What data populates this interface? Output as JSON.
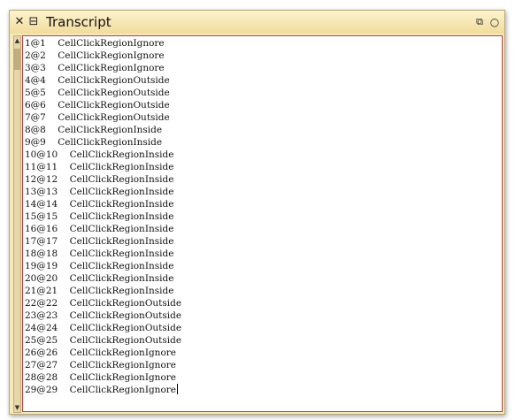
{
  "window": {
    "title": "Transcript",
    "icons": {
      "close": "close-icon",
      "menu": "window-menu-icon",
      "collapse": "collapse-icon",
      "expand": "expand-icon"
    }
  },
  "transcript": {
    "lines": [
      "1@1    CellClickRegionIgnore",
      "2@2    CellClickRegionIgnore",
      "3@3    CellClickRegionIgnore",
      "4@4    CellClickRegionOutside",
      "5@5    CellClickRegionOutside",
      "6@6    CellClickRegionOutside",
      "7@7    CellClickRegionOutside",
      "8@8    CellClickRegionInside",
      "9@9    CellClickRegionInside",
      "10@10    CellClickRegionInside",
      "11@11    CellClickRegionInside",
      "12@12    CellClickRegionInside",
      "13@13    CellClickRegionInside",
      "14@14    CellClickRegionInside",
      "15@15    CellClickRegionInside",
      "16@16    CellClickRegionInside",
      "17@17    CellClickRegionInside",
      "18@18    CellClickRegionInside",
      "19@19    CellClickRegionInside",
      "20@20    CellClickRegionInside",
      "21@21    CellClickRegionInside",
      "22@22    CellClickRegionOutside",
      "23@23    CellClickRegionOutside",
      "24@24    CellClickRegionOutside",
      "25@25    CellClickRegionOutside",
      "26@26    CellClickRegionIgnore",
      "27@27    CellClickRegionIgnore",
      "28@28    CellClickRegionIgnore",
      "29@29    CellClickRegionIgnore"
    ]
  }
}
